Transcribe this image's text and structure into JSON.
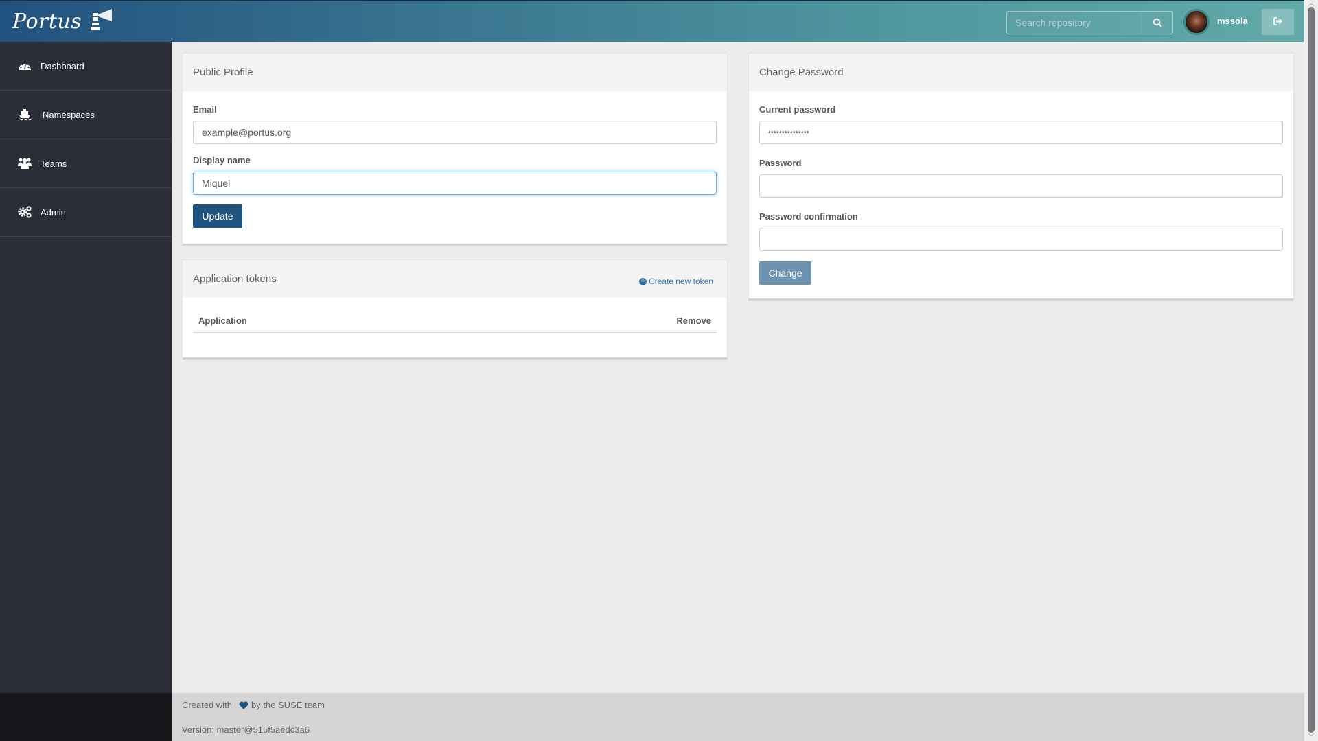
{
  "header": {
    "logo_text": "Portus",
    "search_placeholder": "Search repository",
    "search_icon": "search-icon",
    "username": "mssola",
    "logout_icon": "sign-out-icon"
  },
  "sidebar": {
    "items": [
      {
        "label": "Dashboard",
        "icon": "dashboard-icon"
      },
      {
        "label": "Namespaces",
        "icon": "ship-icon"
      },
      {
        "label": "Teams",
        "icon": "users-icon"
      },
      {
        "label": "Admin",
        "icon": "cogs-icon"
      }
    ]
  },
  "public_profile": {
    "title": "Public Profile",
    "email_label": "Email",
    "email_value": "example@portus.org",
    "display_name_label": "Display name",
    "display_name_value": "Miquel",
    "update_label": "Update"
  },
  "tokens": {
    "title": "Application tokens",
    "create_label": "Create new token",
    "columns": [
      "Application",
      "Remove"
    ],
    "rows": []
  },
  "change_password": {
    "title": "Change Password",
    "current_label": "Current password",
    "current_value": "•••••••••••••••",
    "password_label": "Password",
    "password_value": "",
    "confirmation_label": "Password confirmation",
    "confirmation_value": "",
    "change_label": "Change"
  },
  "footer": {
    "created_prefix": "Created with",
    "created_suffix": "by the SUSE team",
    "version": "Version: master@515f5aedc3a6"
  },
  "colors": {
    "primary": "#205581",
    "sidebar": "#2b2e36",
    "link": "#337ab7"
  }
}
